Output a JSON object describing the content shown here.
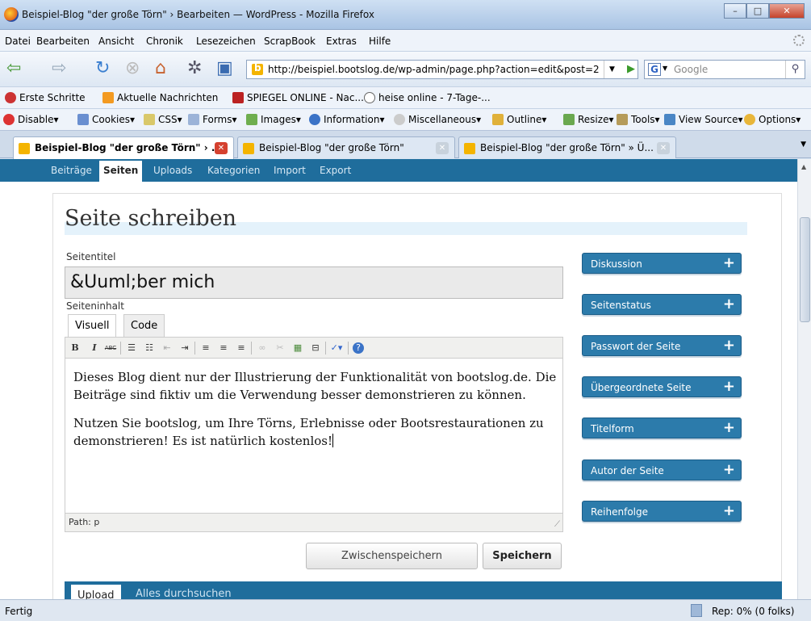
{
  "window": {
    "title": "Beispiel-Blog \"der große Törn\" › Bearbeiten — WordPress - Mozilla Firefox"
  },
  "menu": [
    "Datei",
    "Bearbeiten",
    "Ansicht",
    "Chronik",
    "Lesezeichen",
    "ScrapBook",
    "Extras",
    "Hilfe"
  ],
  "address": {
    "url": "http://beispiel.bootslog.de/wp-admin/page.php?action=edit&post=2",
    "search_placeholder": "Google"
  },
  "bookmarks": [
    "Erste Schritte",
    "Aktuelle Nachrichten",
    "SPIEGEL ONLINE - Nac...",
    "heise online - 7-Tage-..."
  ],
  "devtools": [
    "Disable▾",
    "Cookies▾",
    "CSS▾",
    "Forms▾",
    "Images▾",
    "Information▾",
    "Miscellaneous▾",
    "Outline▾",
    "Resize▾",
    "Tools▾",
    "View Source▾",
    "Options▾"
  ],
  "tabs": [
    "Beispiel-Blog \"der große Törn\" › ...",
    "Beispiel-Blog \"der große Törn\"",
    "Beispiel-Blog \"der große Törn\" » Ü..."
  ],
  "wpnav": [
    "Beiträge",
    "Seiten",
    "Uploads",
    "Kategorien",
    "Import",
    "Export"
  ],
  "page": {
    "heading": "Seite schreiben",
    "title_label": "Seitentitel",
    "title_value": "&Uuml;ber mich",
    "content_label": "Seiteninhalt",
    "tab_visual": "Visuell",
    "tab_code": "Code",
    "paragraph1": "Dieses Blog dient nur der Illustrierung der Funktionalität von bootslog.de. Die Beiträge sind fiktiv um die Verwendung besser demonstrieren zu können.",
    "paragraph2": "Nutzen Sie bootslog, um Ihre Törns, Erlebnisse oder Bootsrestaurationen zu demonstrieren! Es ist natürlich kostenlos!",
    "path": "Path: p",
    "btn_draft": "Zwischenspeichern",
    "btn_save": "Speichern"
  },
  "sidebar": [
    "Diskussion",
    "Seitenstatus",
    "Passwort der Seite",
    "Übergeordnete Seite",
    "Titelform",
    "Autor der Seite",
    "Reihenfolge"
  ],
  "upload": {
    "tab1": "Upload",
    "tab2": "Alles durchsuchen"
  },
  "status": {
    "left": "Fertig",
    "right": "Rep: 0% (0 folks)"
  },
  "colors": {
    "wp_blue": "#1f6d9c",
    "sidebox": "#2c7bab"
  }
}
